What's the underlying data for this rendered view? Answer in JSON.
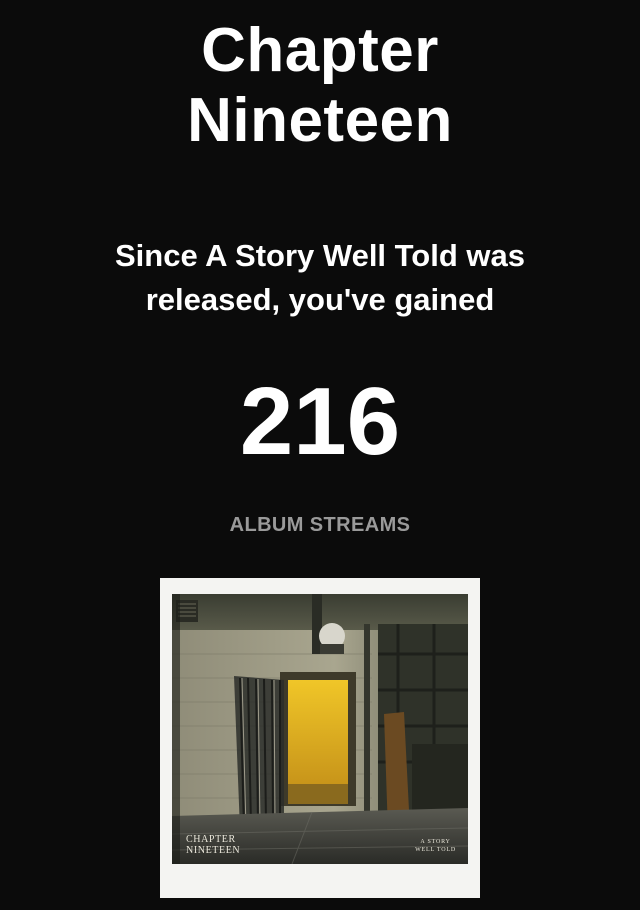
{
  "card": {
    "title_line1": "Chapter",
    "title_line2": "Nineteen",
    "subtitle_line1": "Since A Story Well Told was",
    "subtitle_line2": "released, you've gained",
    "count": "216",
    "metric_label": "ALBUM STREAMS"
  },
  "album_art": {
    "artist_line1": "CHAPTER",
    "artist_line2": "NINETEEN",
    "album_line1": "A STORY",
    "album_line2": "WELL TOLD"
  },
  "colors": {
    "background": "#0b0b0b",
    "text": "#ffffff",
    "metric_label": "#9a9a9a",
    "frame": "#f4f4f2",
    "door_glow": "#e8b820"
  }
}
